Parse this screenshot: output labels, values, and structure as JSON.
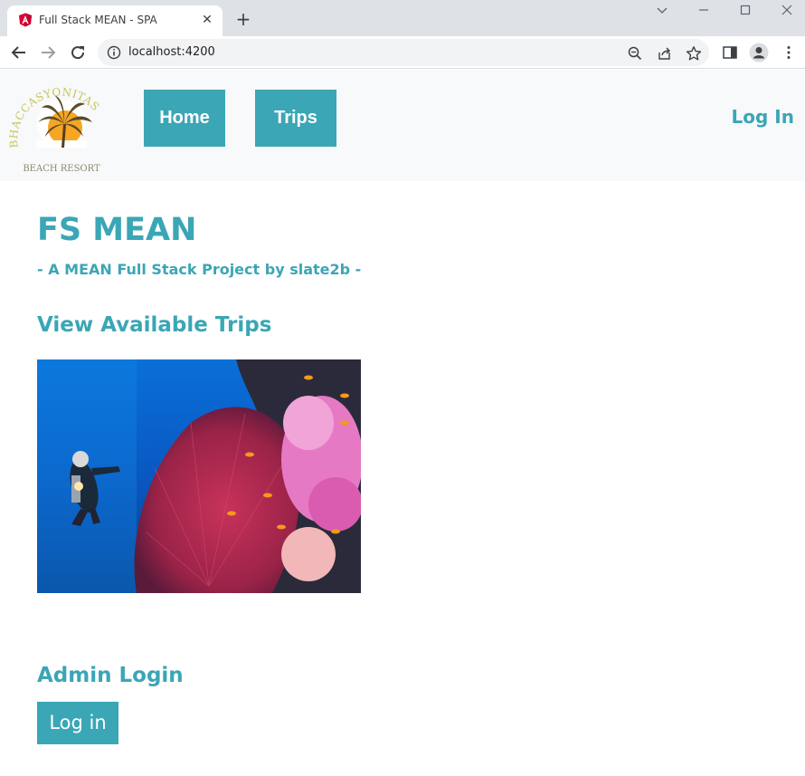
{
  "browser": {
    "tab_title": "Full Stack MEAN - SPA",
    "url": "localhost:4200"
  },
  "header": {
    "logo_text": {
      "top": "BHACCASYONITAS",
      "bottom": "BEACH RESORT"
    },
    "nav": [
      {
        "label": "Home"
      },
      {
        "label": "Trips"
      }
    ],
    "login_label": "Log In"
  },
  "main": {
    "title": "FS MEAN",
    "subtitle": "- A MEAN Full Stack Project by slate2b -",
    "trips_heading": "View Available Trips",
    "admin_heading": "Admin Login",
    "admin_login_button": "Log in"
  },
  "colors": {
    "accent": "#3ba6b5",
    "header_bg": "#f8f9fa",
    "tabstrip_bg": "#dee1e6"
  }
}
